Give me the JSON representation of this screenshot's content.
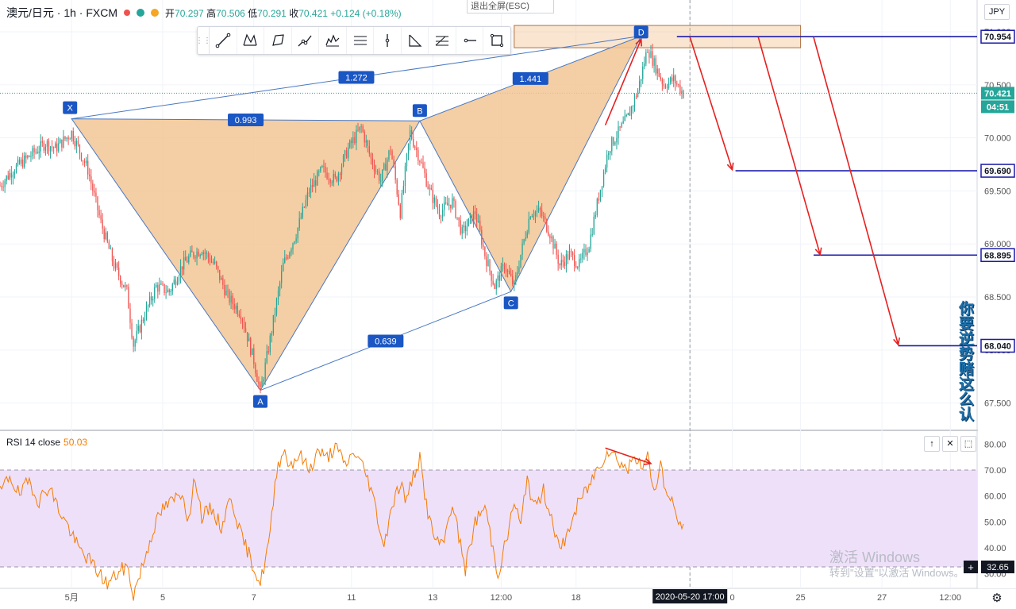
{
  "header": {
    "symbol": "澳元/日元 · 1h · FXCM",
    "open_label": "开",
    "open": "70.297",
    "high_label": "高",
    "high": "70.506",
    "low_label": "低",
    "low": "70.291",
    "close_label": "收",
    "close": "70.421",
    "change": "+0.124 (+0.18%)"
  },
  "exit_fullscreen": "退出全屏(ESC)",
  "currency": "JPY",
  "toolbar_icons": [
    "trend-line-icon",
    "xabcd-pattern-icon",
    "abcd-pattern-icon",
    "path-icon",
    "elliott-wave-icon",
    "parallel-channel-icon",
    "vertical-line-icon",
    "triangle-icon",
    "fib-icon",
    "horizontal-ray-icon",
    "rectangle-icon"
  ],
  "colors": {
    "up": "#26a69a",
    "down": "#ef5350",
    "pattern_fill": "#f2c594",
    "pattern_line": "#4a78c2",
    "label_bg": "#1a56c4",
    "rsi_line": "#f57c00",
    "rsi_band": "#efe0fa",
    "target_line": "#1a1aa8",
    "arrow": "#e52020"
  },
  "rsi_legend": {
    "label": "RSI 14 close",
    "value": "50.03"
  },
  "rsi_controls": [
    "↑",
    "✕",
    "⬚"
  ],
  "watermark": {
    "line1": "激活 Windows",
    "line2": "转到\"设置\"以激活 Windows。"
  },
  "side_text": "你要逆势赌这么认",
  "chart_data": {
    "type": "candlestick",
    "title": "",
    "x_ticks": [
      {
        "label": "5月",
        "i": 22
      },
      {
        "label": "5",
        "i": 50
      },
      {
        "label": "7",
        "i": 78
      },
      {
        "label": "11",
        "i": 108
      },
      {
        "label": "13",
        "i": 133
      },
      {
        "label": "12:00",
        "i": 154
      },
      {
        "label": "18",
        "i": 177
      },
      {
        "label": "2020-05-20   17:00",
        "i": 212
      },
      {
        "label": "0",
        "i": 225
      },
      {
        "label": "25",
        "i": 246
      },
      {
        "label": "27",
        "i": 271
      },
      {
        "label": "12:00",
        "i": 292
      }
    ],
    "y_ticks": [
      67.5,
      68.0,
      68.5,
      69.0,
      69.5,
      70.0,
      70.5,
      71.0
    ],
    "ylim": [
      67.25,
      71.3
    ],
    "candles_anchor_path": [
      [
        0,
        69.55
      ],
      [
        4,
        69.7
      ],
      [
        10,
        69.85
      ],
      [
        14,
        69.95
      ],
      [
        17,
        69.9
      ],
      [
        22,
        70.05
      ],
      [
        27,
        69.7
      ],
      [
        31,
        69.2
      ],
      [
        35,
        68.8
      ],
      [
        39,
        68.55
      ],
      [
        41,
        68.05
      ],
      [
        44,
        68.3
      ],
      [
        48,
        68.6
      ],
      [
        52,
        68.55
      ],
      [
        56,
        68.8
      ],
      [
        59,
        68.9
      ],
      [
        62,
        68.95
      ],
      [
        66,
        68.8
      ],
      [
        70,
        68.5
      ],
      [
        74,
        68.35
      ],
      [
        78,
        67.9
      ],
      [
        80,
        67.6
      ],
      [
        83,
        68.1
      ],
      [
        87,
        68.8
      ],
      [
        91,
        69.1
      ],
      [
        95,
        69.5
      ],
      [
        99,
        69.7
      ],
      [
        103,
        69.6
      ],
      [
        107,
        69.9
      ],
      [
        111,
        70.1
      ],
      [
        114,
        69.8
      ],
      [
        117,
        69.6
      ],
      [
        120,
        69.9
      ],
      [
        123,
        69.3
      ],
      [
        126,
        70.05
      ],
      [
        129,
        69.8
      ],
      [
        132,
        69.5
      ],
      [
        135,
        69.3
      ],
      [
        139,
        69.4
      ],
      [
        142,
        69.1
      ],
      [
        146,
        69.3
      ],
      [
        149,
        68.9
      ],
      [
        152,
        68.6
      ],
      [
        155,
        68.8
      ],
      [
        158,
        68.6
      ],
      [
        160,
        68.9
      ],
      [
        163,
        69.3
      ],
      [
        166,
        69.3
      ],
      [
        169,
        69.1
      ],
      [
        172,
        68.8
      ],
      [
        175,
        68.9
      ],
      [
        178,
        68.8
      ],
      [
        181,
        69.0
      ],
      [
        184,
        69.45
      ],
      [
        187,
        69.9
      ],
      [
        190,
        70.05
      ],
      [
        193,
        70.2
      ],
      [
        196,
        70.45
      ],
      [
        199,
        70.85
      ],
      [
        201,
        70.7
      ],
      [
        204,
        70.5
      ],
      [
        207,
        70.55
      ],
      [
        210,
        70.42
      ]
    ],
    "pattern": {
      "points": [
        {
          "name": "X",
          "x": 22,
          "y": 70.18
        },
        {
          "name": "A",
          "x": 80,
          "y": 67.62
        },
        {
          "name": "B",
          "x": 129,
          "y": 70.16
        },
        {
          "name": "C",
          "x": 157,
          "y": 68.55
        },
        {
          "name": "D",
          "x": 197,
          "y": 70.96
        }
      ],
      "ratios": [
        {
          "label": "1.272",
          "from": "X",
          "to": "D"
        },
        {
          "label": "0.993",
          "from": "X",
          "to": "B"
        },
        {
          "label": "1.441",
          "from": "B",
          "to": "D"
        },
        {
          "label": "0.639",
          "from": "A",
          "to": "C"
        }
      ]
    },
    "d_zone": {
      "x0": 158,
      "x1": 246,
      "y0": 70.85,
      "y1": 71.06
    },
    "targets": [
      {
        "label": "70.954",
        "value": 70.954,
        "x0": 208
      },
      {
        "label": "69.690",
        "value": 69.69,
        "x0": 226
      },
      {
        "label": "68.895",
        "value": 68.895,
        "x0": 250
      },
      {
        "label": "68.040",
        "value": 68.04,
        "x0": 276
      }
    ],
    "last_price": {
      "label": "70.421",
      "value": 70.421,
      "countdown": "04:51"
    },
    "arrows": [
      {
        "x0": 212,
        "y0": 70.95,
        "x1": 225,
        "y1": 69.7
      },
      {
        "x0": 233,
        "y0": 70.95,
        "x1": 252,
        "y1": 68.9
      },
      {
        "x0": 250,
        "y0": 70.95,
        "x1": 276,
        "y1": 68.05
      },
      {
        "x0": 186,
        "y0": 70.12,
        "x1": 197,
        "y1": 70.93
      }
    ],
    "rsi": {
      "name": "RSI 14 close",
      "ylim": [
        25,
        85
      ],
      "y_ticks": [
        30.0,
        40.0,
        50.0,
        60.0,
        70.0,
        80.0
      ],
      "band": [
        32.65,
        70
      ],
      "current": "50.03",
      "cross_label": "32.65",
      "anchor_path": [
        [
          0,
          61
        ],
        [
          3,
          68
        ],
        [
          6,
          60
        ],
        [
          9,
          66
        ],
        [
          12,
          58
        ],
        [
          15,
          64
        ],
        [
          18,
          55
        ],
        [
          21,
          48
        ],
        [
          24,
          40
        ],
        [
          27,
          36
        ],
        [
          30,
          31
        ],
        [
          33,
          26
        ],
        [
          36,
          30
        ],
        [
          39,
          33
        ],
        [
          41,
          22
        ],
        [
          44,
          34
        ],
        [
          47,
          47
        ],
        [
          50,
          55
        ],
        [
          53,
          58
        ],
        [
          56,
          62
        ],
        [
          58,
          50
        ],
        [
          60,
          68
        ],
        [
          62,
          52
        ],
        [
          65,
          55
        ],
        [
          68,
          48
        ],
        [
          71,
          60
        ],
        [
          74,
          45
        ],
        [
          77,
          36
        ],
        [
          80,
          26
        ],
        [
          83,
          45
        ],
        [
          85,
          70
        ],
        [
          87,
          78
        ],
        [
          89,
          72
        ],
        [
          92,
          76
        ],
        [
          95,
          70
        ],
        [
          98,
          78
        ],
        [
          100,
          74
        ],
        [
          103,
          79
        ],
        [
          106,
          72
        ],
        [
          109,
          77
        ],
        [
          112,
          70
        ],
        [
          114,
          63
        ],
        [
          116,
          52
        ],
        [
          118,
          40
        ],
        [
          120,
          55
        ],
        [
          123,
          65
        ],
        [
          125,
          58
        ],
        [
          127,
          68
        ],
        [
          129,
          74
        ],
        [
          131,
          57
        ],
        [
          133,
          45
        ],
        [
          136,
          40
        ],
        [
          139,
          58
        ],
        [
          141,
          44
        ],
        [
          143,
          32
        ],
        [
          146,
          50
        ],
        [
          149,
          56
        ],
        [
          151,
          43
        ],
        [
          153,
          30
        ],
        [
          156,
          45
        ],
        [
          158,
          58
        ],
        [
          160,
          48
        ],
        [
          162,
          68
        ],
        [
          164,
          55
        ],
        [
          167,
          62
        ],
        [
          170,
          50
        ],
        [
          172,
          38
        ],
        [
          175,
          48
        ],
        [
          178,
          58
        ],
        [
          181,
          64
        ],
        [
          184,
          72
        ],
        [
          187,
          78
        ],
        [
          190,
          74
        ],
        [
          193,
          70
        ],
        [
          195,
          77
        ],
        [
          197,
          70
        ],
        [
          199,
          75
        ],
        [
          201,
          62
        ],
        [
          203,
          72
        ],
        [
          205,
          60
        ],
        [
          207,
          56
        ],
        [
          209,
          48
        ],
        [
          210,
          50
        ]
      ],
      "divergence_arrow": {
        "x0": 186,
        "y0": 78.5,
        "x1": 200,
        "y1": 72.5
      }
    }
  }
}
